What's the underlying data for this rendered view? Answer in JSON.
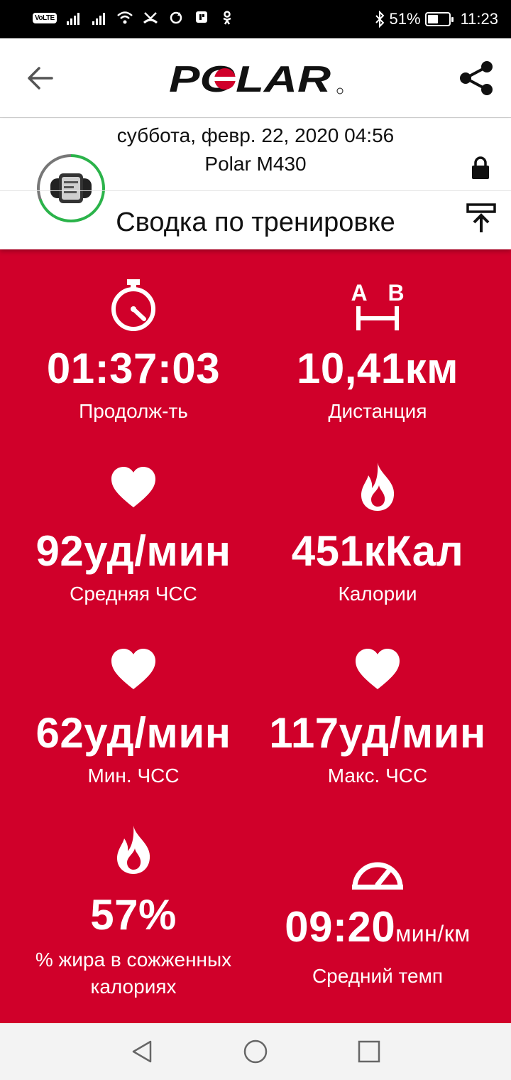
{
  "status_bar": {
    "volte": "VoLTE",
    "battery_percent": "51%",
    "battery_level": 0.51,
    "time": "11:23"
  },
  "app_bar": {
    "logo_text": "POLAR"
  },
  "session": {
    "date": "суббота, февр. 22, 2020 04:56",
    "device": "Polar M430",
    "title": "Сводка по тренировке"
  },
  "metrics": {
    "duration": {
      "value": "01:37:03",
      "label": "Продолж-ть",
      "icon": "stopwatch-icon"
    },
    "distance": {
      "icon_a": "A",
      "icon_b": "B",
      "value": "10,41",
      "unit": "км",
      "label": "Дистанция",
      "icon": "distance-ab-icon"
    },
    "avg_hr": {
      "value": "92",
      "unit": "уд/мин",
      "label": "Средняя ЧСС",
      "icon": "heart-icon"
    },
    "calories": {
      "value": "451",
      "unit": "кКал",
      "label": "Калории",
      "icon": "flame-icon"
    },
    "min_hr": {
      "value": "62",
      "unit": "уд/мин",
      "label": "Мин. ЧСС",
      "icon": "heart-icon"
    },
    "max_hr": {
      "value": "117",
      "unit": "уд/мин",
      "label": "Макс. ЧСС",
      "icon": "heart-icon"
    },
    "fat_percent": {
      "value": "57%",
      "label_line1": "% жира в сожженных",
      "label_line2": "калориях",
      "icon": "flame-icon"
    },
    "avg_pace": {
      "value": "09:20",
      "unit": "мин/км",
      "label": "Средний темп",
      "icon": "speedometer-icon"
    }
  },
  "colors": {
    "accent": "#d0002a",
    "progress_ring": "#2bb34a"
  }
}
